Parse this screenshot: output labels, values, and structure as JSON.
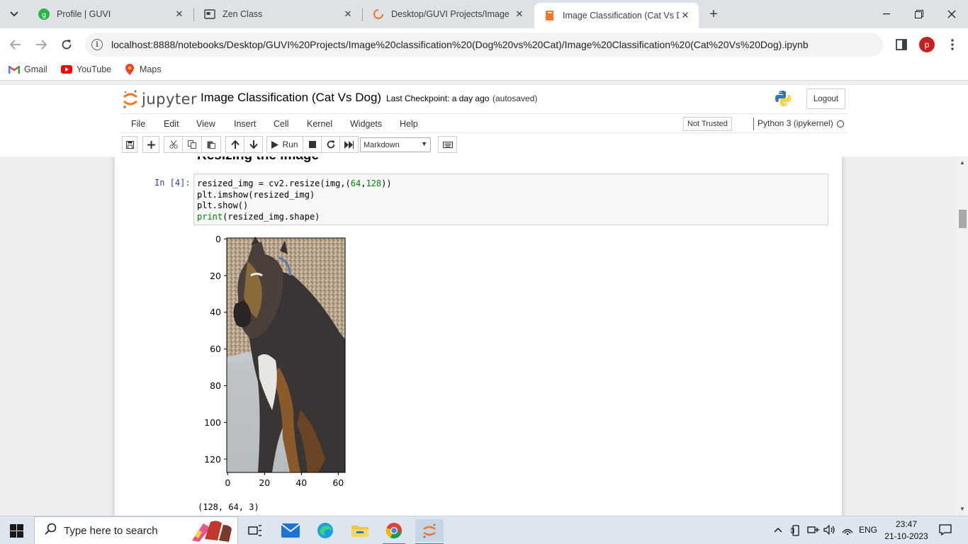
{
  "browser": {
    "tabs": [
      {
        "title": "Profile | GUVI",
        "active": false
      },
      {
        "title": "Zen Class",
        "active": false
      },
      {
        "title": "Desktop/GUVI Projects/Image",
        "active": false
      },
      {
        "title": "Image Classification (Cat Vs Do",
        "active": true
      }
    ],
    "url": "localhost:8888/notebooks/Desktop/GUVI%20Projects/Image%20classification%20(Dog%20vs%20Cat)/Image%20Classification%20(Cat%20Vs%20Dog).ipynb",
    "profile_initial": "p",
    "bookmarks": [
      "Gmail",
      "YouTube",
      "Maps"
    ]
  },
  "jupyter": {
    "logo_text": "jupyter",
    "notebook_name": "Image Classification (Cat Vs Dog)",
    "checkpoint": "Last Checkpoint: a day ago",
    "autosave": "(autosaved)",
    "logout": "Logout",
    "menu": [
      "File",
      "Edit",
      "View",
      "Insert",
      "Cell",
      "Kernel",
      "Widgets",
      "Help"
    ],
    "trust": "Not Trusted",
    "kernel": "Python 3 (ipykernel)",
    "run_label": "Run",
    "cell_type": "Markdown"
  },
  "notebook": {
    "heading_partial": "Resizing the image",
    "prompt": "In [4]:",
    "code": [
      "resized_img = cv2.resize(img,(64,128))",
      "plt.imshow(resized_img)",
      "plt.show()",
      "print(resized_img.shape)"
    ],
    "output_text": "(128, 64, 3)",
    "plot": {
      "y_ticks": [
        "0",
        "20",
        "40",
        "60",
        "80",
        "100",
        "120"
      ],
      "x_ticks": [
        "0",
        "20",
        "40",
        "60"
      ]
    }
  },
  "taskbar": {
    "search_placeholder": "Type here to search",
    "language": "ENG",
    "time": "23:47",
    "date": "21-10-2023"
  }
}
